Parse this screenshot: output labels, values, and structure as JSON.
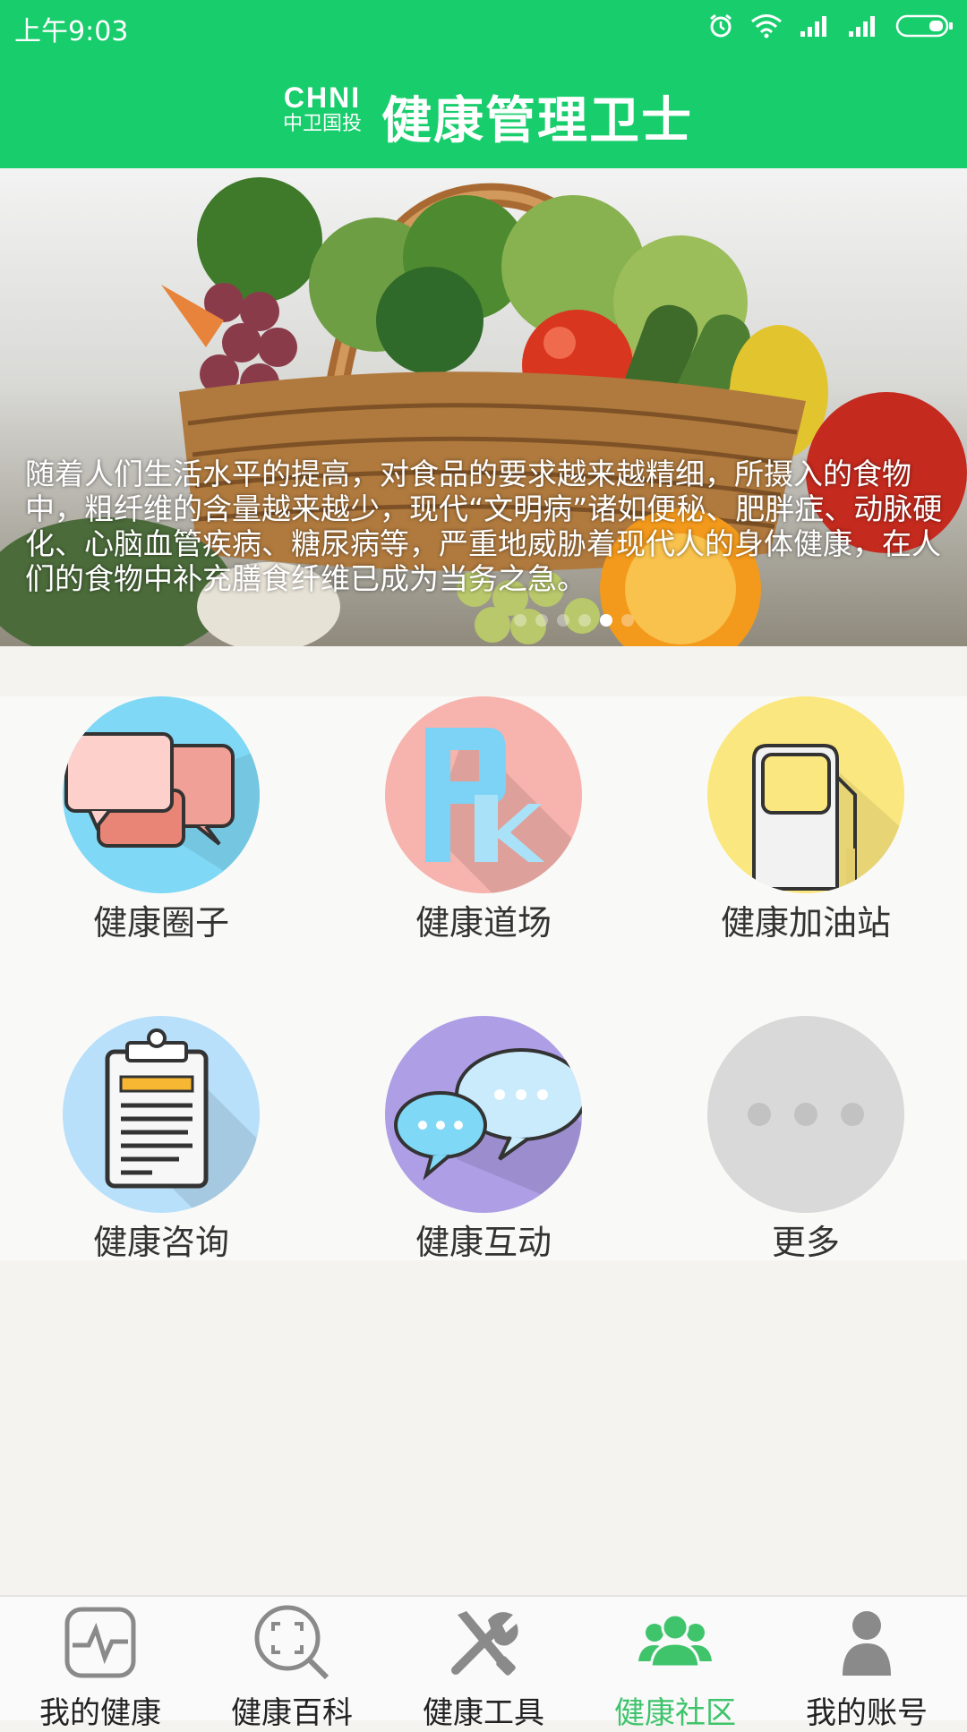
{
  "status_bar": {
    "time": "上午9:03",
    "icons": [
      "alarm-icon",
      "wifi-icon",
      "signal-icon",
      "signal-icon",
      "battery-icon"
    ]
  },
  "header": {
    "logo_en": "CHNI",
    "logo_cn": "中卫国投",
    "title": "健康管理卫士",
    "color": "#18cd6c"
  },
  "banner": {
    "caption": "随着人们生活水平的提高，对食品的要求越来越精细，所摄入的食物中，粗纤维的含量越来越少，现代“文明病”诸如便秘、肥胖症、动脉硬化、心脑血管疾病、糖尿病等，严重地威胁着现代人的身体健康，在人们的食物中补充膳食纤维已成为当务之急。",
    "image": "vegetable-basket-photo",
    "dots": 6,
    "active_dot": 5
  },
  "features": [
    {
      "label": "健康圈子",
      "icon": "chat-bubbles-icon",
      "color": "#7fd8f5"
    },
    {
      "label": "健康道场",
      "icon": "pk-icon",
      "color": "#f7b3ad"
    },
    {
      "label": "健康加油站",
      "icon": "fuel-pump-icon",
      "color": "#fbe77f"
    },
    {
      "label": "健康咨询",
      "icon": "clipboard-icon",
      "color": "#b8e0fb"
    },
    {
      "label": "健康互动",
      "icon": "message-bubbles-icon",
      "color": "#ae9ee6"
    },
    {
      "label": "更多",
      "icon": "more-icon",
      "color": "#d9d9d9"
    }
  ],
  "tabs": [
    {
      "label": "我的健康",
      "icon": "heart-monitor-icon",
      "active": false
    },
    {
      "label": "健康百科",
      "icon": "scan-search-icon",
      "active": false
    },
    {
      "label": "健康工具",
      "icon": "tools-icon",
      "active": false
    },
    {
      "label": "健康社区",
      "icon": "community-icon",
      "active": true
    },
    {
      "label": "我的账号",
      "icon": "user-icon",
      "active": false
    }
  ],
  "active_color": "#3fc46c"
}
